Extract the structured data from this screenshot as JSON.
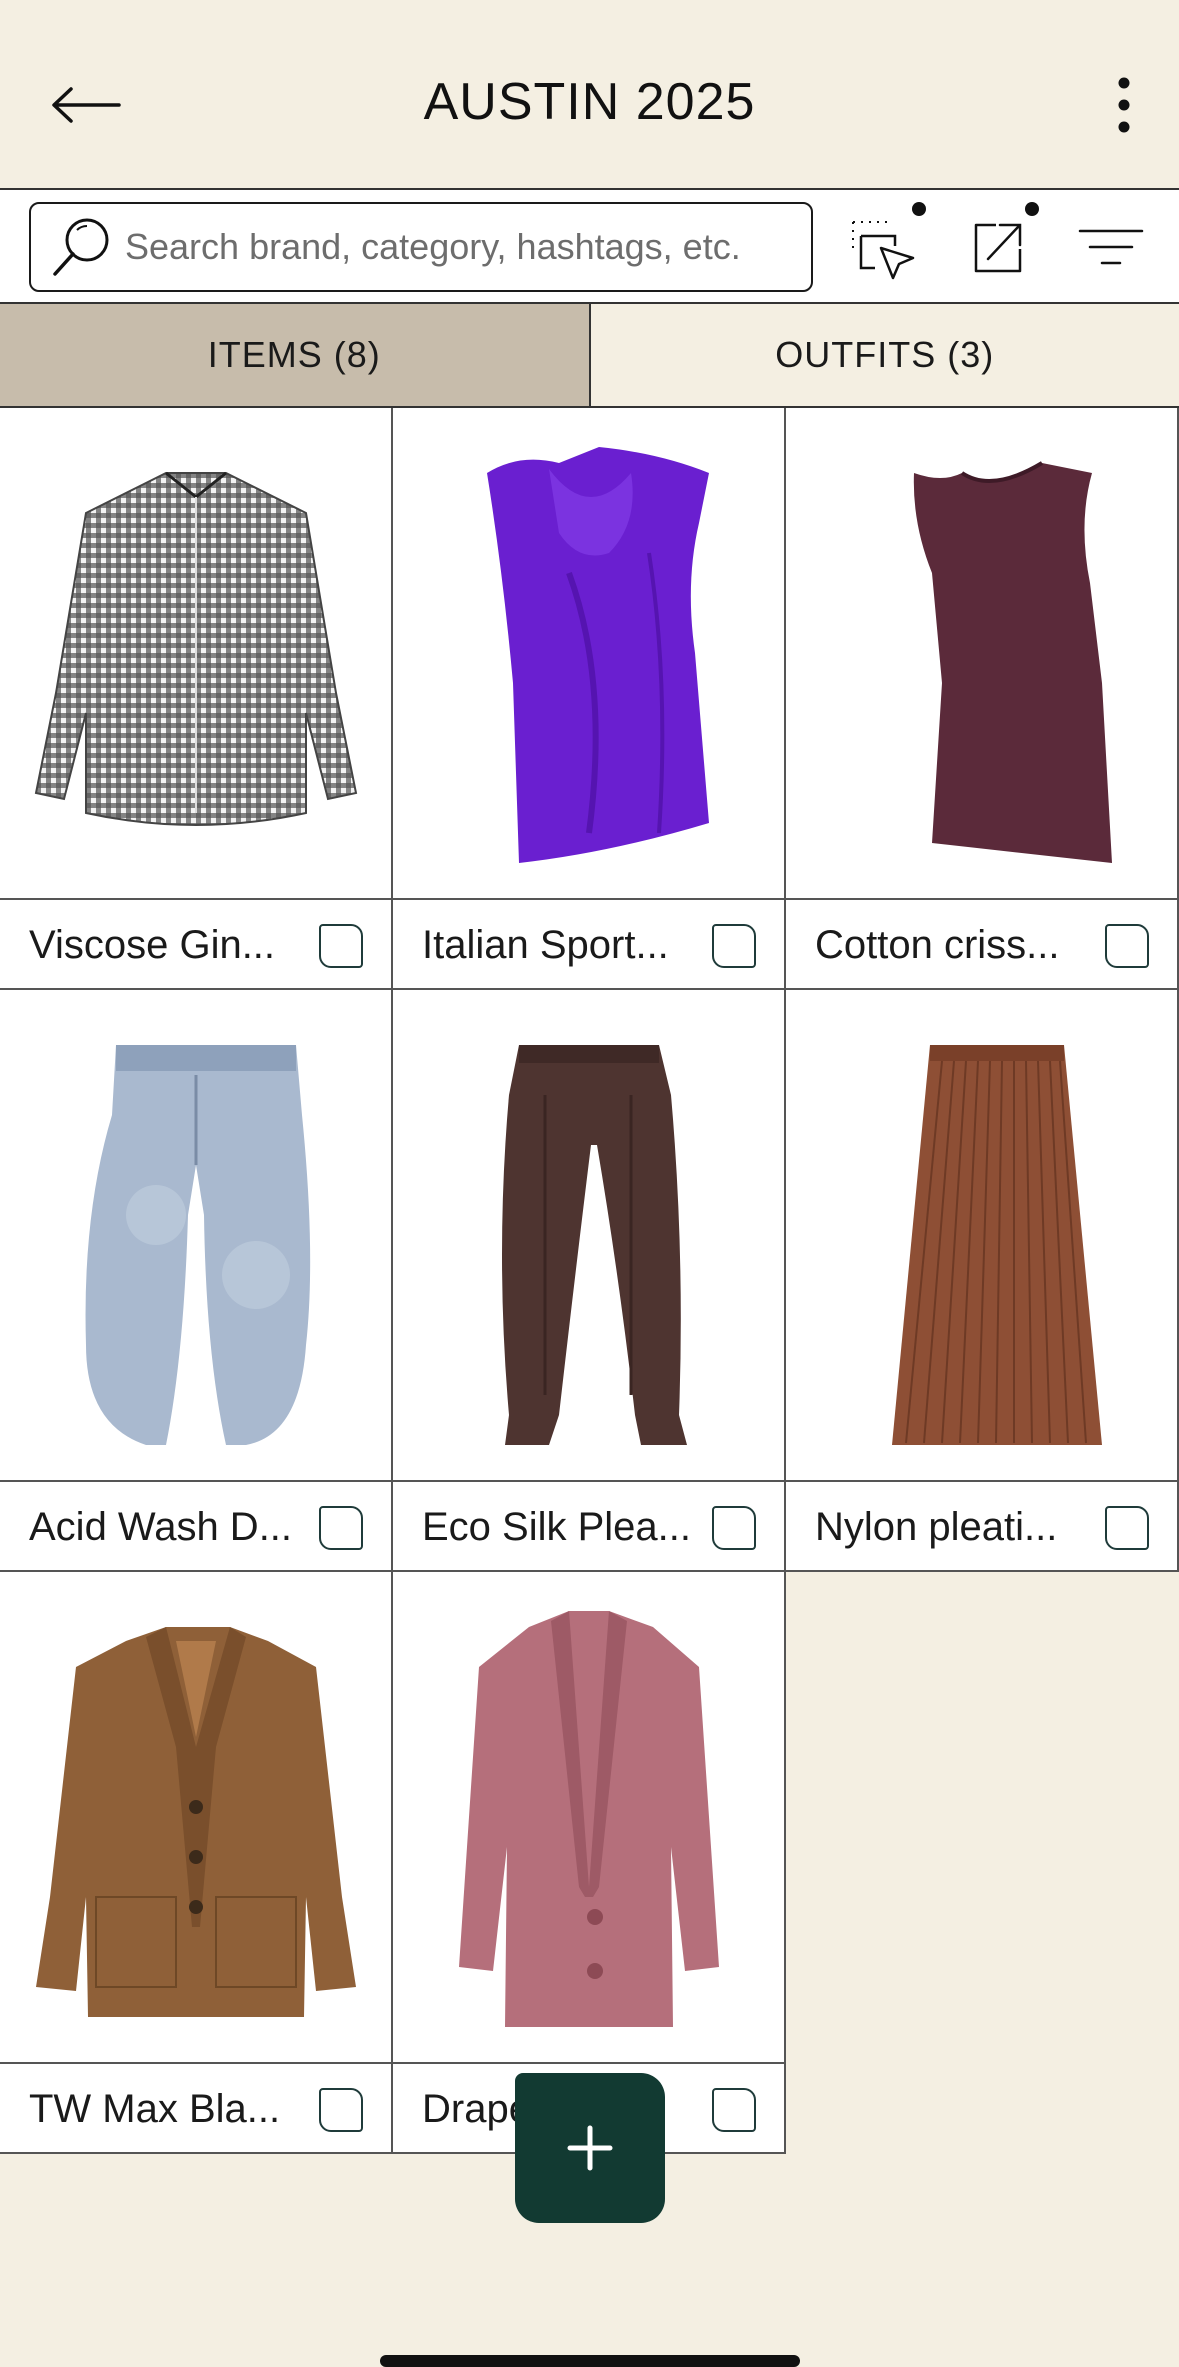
{
  "header": {
    "title": "AUSTIN 2025",
    "back_icon": "arrow-left-icon",
    "more_icon": "more-vertical-icon"
  },
  "toolbar": {
    "search_placeholder": "Search brand, category, hashtags, etc.",
    "search_icon": "search-icon",
    "select_icon": "select-pointer-icon",
    "share_icon": "share-external-icon",
    "filter_icon": "filter-lines-icon"
  },
  "tabs": [
    {
      "label": "ITEMS (8)",
      "active": true
    },
    {
      "label": "OUTFITS (3)",
      "active": false
    }
  ],
  "items": [
    {
      "label": "Viscose Gin...",
      "image": "gingham-shirt",
      "color": "#3a3a3a"
    },
    {
      "label": "Italian Sport...",
      "image": "purple-draped-top",
      "color": "#6a1fd0"
    },
    {
      "label": "Cotton criss...",
      "image": "maroon-sleeveless-top",
      "color": "#5b2a3a"
    },
    {
      "label": "Acid Wash D...",
      "image": "acid-wash-jeans",
      "color": "#a9b9cf"
    },
    {
      "label": "Eco Silk Plea...",
      "image": "brown-silk-trousers",
      "color": "#4e3430"
    },
    {
      "label": "Nylon pleati...",
      "image": "pleated-skirt",
      "color": "#8e4f35"
    },
    {
      "label": "TW Max Bla...",
      "image": "camel-blazer",
      "color": "#8f6038"
    },
    {
      "label": "Drape...",
      "image": "pink-blazer",
      "color": "#b56f7b"
    }
  ],
  "fab": {
    "label": "+",
    "icon": "plus-icon"
  }
}
